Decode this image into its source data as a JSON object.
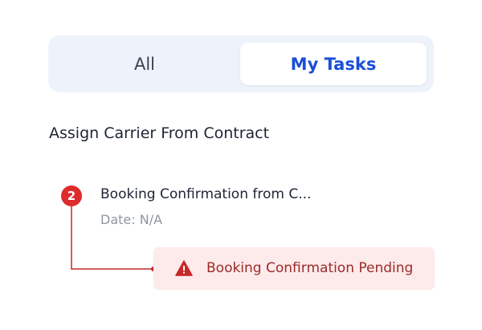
{
  "tabs": [
    {
      "label": "All",
      "active": false
    },
    {
      "label": "My Tasks",
      "active": true
    }
  ],
  "section": {
    "title": "Assign Carrier From Contract"
  },
  "task": {
    "step": "2",
    "title": "Booking Confirmation from C...",
    "date": "Date: N/A"
  },
  "alert": {
    "icon": "warning-icon",
    "text": "Booking Confirmation Pending"
  },
  "colors": {
    "accent": "#1a4fd6",
    "tab_bar_bg": "#eef3fb",
    "step_badge": "#de2b2b",
    "alert_bg": "#fdeaea",
    "alert_text": "#9b2a2a",
    "muted_text": "#8e95a1"
  }
}
